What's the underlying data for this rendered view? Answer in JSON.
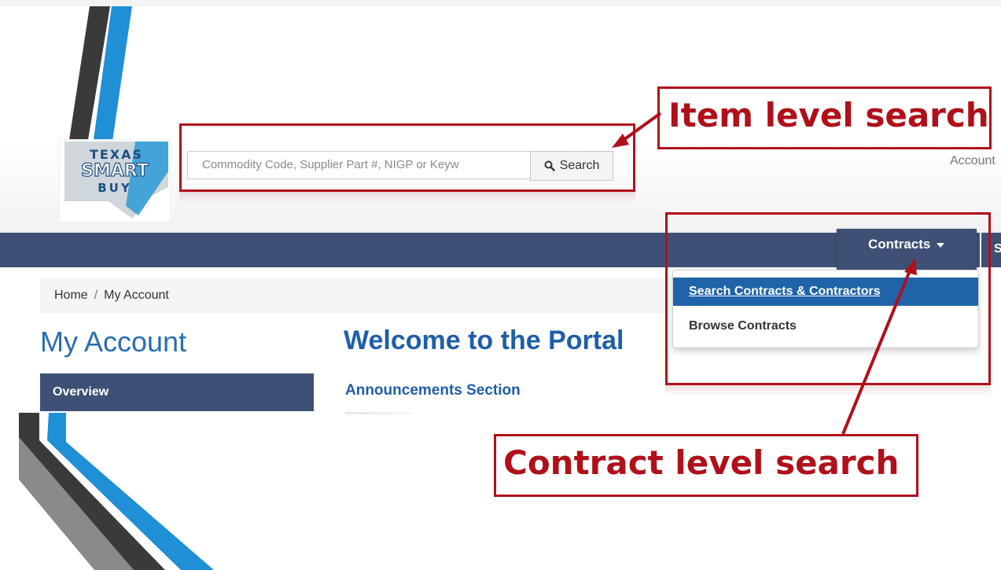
{
  "logo": {
    "line1": "TEXAS",
    "line2": "SMART",
    "line3": "BUY"
  },
  "search": {
    "placeholder": "Commodity Code, Supplier Part #, NIGP or Keyw",
    "button_label": "Search",
    "button_icon": "search-icon"
  },
  "header": {
    "account_link": "Account"
  },
  "nav": {
    "contracts_label": "Contracts",
    "next_tab_fragment": "S"
  },
  "contracts_menu": {
    "items": [
      {
        "label": "Search Contracts & Contractors",
        "active": true
      },
      {
        "label": "Browse Contracts",
        "active": false
      }
    ]
  },
  "breadcrumb": {
    "home": "Home",
    "separator": "/",
    "current": "My Account"
  },
  "sidebar": {
    "title": "My Account",
    "overview": "Overview"
  },
  "main": {
    "welcome": "Welcome to the Portal",
    "announcements": "Announcements Section"
  },
  "annotations": {
    "item_search": "Item level search",
    "contract_search": "Contract level search"
  },
  "colors": {
    "navbar": "#3e5076",
    "accent_blue": "#1f64a8",
    "callout_red": "#b0101a",
    "logo_blue": "#2b9ad6"
  }
}
